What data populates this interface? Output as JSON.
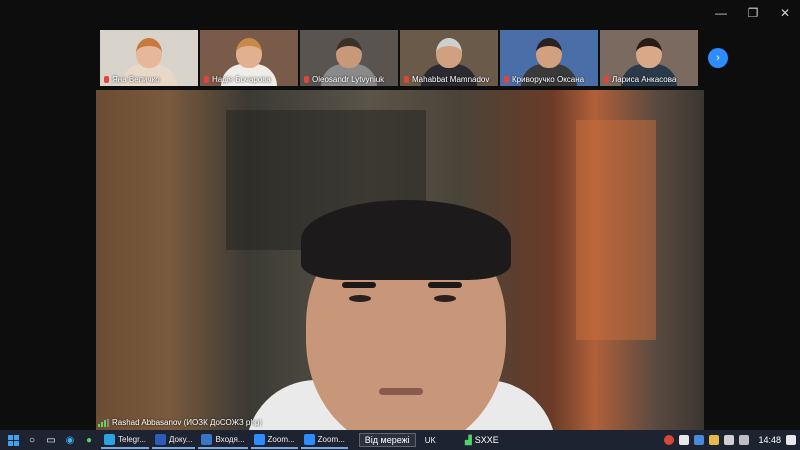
{
  "window": {
    "controls": {
      "minimize": "—",
      "maximize": "❐",
      "close": "✕"
    }
  },
  "participants": [
    {
      "name": "Яна Величко",
      "bg": "#d8d4cc",
      "skin": "#e6b79a",
      "hair": "#c97a3a",
      "cloth": "#e8d8c8"
    },
    {
      "name": "Надія Бочарова",
      "bg": "#7a5a48",
      "skin": "#e0b090",
      "hair": "#c88a4a",
      "cloth": "#f0ece8"
    },
    {
      "name": "Oleosandr Lytvyniuk",
      "bg": "#5a5450",
      "skin": "#c8987a",
      "hair": "#3a3028",
      "cloth": "#8a8a8a"
    },
    {
      "name": "Mahabbat Mamnadov",
      "bg": "#6a5a4a",
      "skin": "#d0a080",
      "hair": "#cfcfcf",
      "cloth": "#2a2a30"
    },
    {
      "name": "Криворучко Оксана",
      "bg": "#4a6fa8",
      "skin": "#d0a080",
      "hair": "#2a2020",
      "cloth": "#3a3a3a"
    },
    {
      "name": "Лариса Анкасова",
      "bg": "#7a6a60",
      "skin": "#d8a888",
      "hair": "#2a1a18",
      "cloth": "#2a3a4a"
    }
  ],
  "next_page_icon": "chevron-right-icon",
  "active_speaker": {
    "name": "Rashad Abbasanov (ИОЗК ДоСОЖЗ рhр)"
  },
  "taskbar": {
    "apps": [
      {
        "label": "Telegr...",
        "color": "#2aa3e0"
      },
      {
        "label": "Доку...",
        "color": "#2b5cb8"
      },
      {
        "label": "Входя...",
        "color": "#3a74c8"
      },
      {
        "label": "Zoom...",
        "color": "#2d8cff"
      },
      {
        "label": "Zoom...",
        "color": "#2d8cff"
      }
    ],
    "offline_label": "Від мережі",
    "language": "UK",
    "stock_label": "SXXE",
    "clock": "14:48"
  }
}
